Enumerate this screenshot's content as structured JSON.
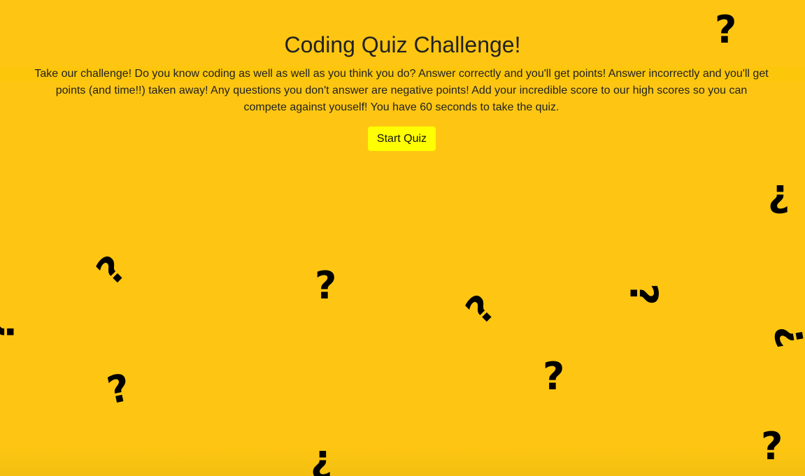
{
  "page": {
    "title": "Coding Quiz Challenge!",
    "intro": "Take our challenge! Do you know coding as well as well as you think you do? Answer correctly and you'll get points! Answer incorrectly and you'll get points (and time!!) taken away! Any questions you don't answer are negative points! Add your incredible score to our high scores so you can compete against youself! You have 60 seconds to take the quiz.",
    "start_button_label": "Start Quiz"
  },
  "decorations": {
    "glyph": "?",
    "icon": "question-mark-icon"
  },
  "colors": {
    "background": "#fec612",
    "button": "#ffff00",
    "text": "#222222"
  }
}
